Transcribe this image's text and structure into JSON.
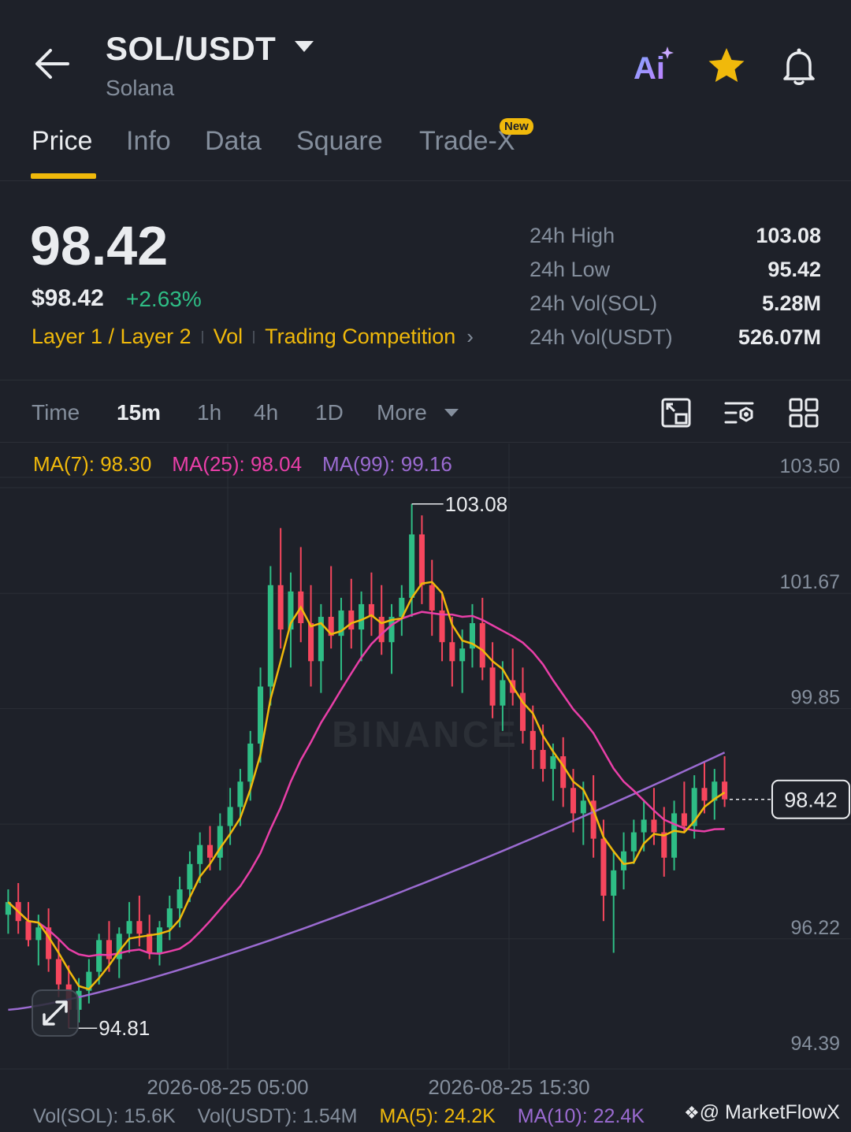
{
  "header": {
    "pair": "SOL/USDT",
    "name": "Solana",
    "ai_label": "Ai"
  },
  "tabs": [
    {
      "label": "Price",
      "active": true
    },
    {
      "label": "Info"
    },
    {
      "label": "Data"
    },
    {
      "label": "Square"
    },
    {
      "label": "Trade-X",
      "badge": "New"
    }
  ],
  "price": {
    "last": "98.42",
    "usd": "$98.42",
    "change": "+2.63%",
    "tags": [
      "Layer 1 / Layer 2",
      "Vol",
      "Trading Competition"
    ]
  },
  "stats": [
    {
      "label": "24h High",
      "value": "103.08"
    },
    {
      "label": "24h Low",
      "value": "95.42"
    },
    {
      "label": "24h Vol(SOL)",
      "value": "5.28M"
    },
    {
      "label": "24h Vol(USDT)",
      "value": "526.07M"
    }
  ],
  "intervals": {
    "time": "Time",
    "items": [
      "15m",
      "1h",
      "4h",
      "1D"
    ],
    "active": "15m",
    "more": "More"
  },
  "ma_legend": {
    "ma7": "MA(7): 98.30",
    "ma25": "MA(25): 98.04",
    "ma99": "MA(99): 99.16"
  },
  "chart_data": {
    "type": "candlestick",
    "y_axis_ticks": [
      "103.50",
      "101.67",
      "99.85",
      "98.42",
      "96.22",
      "94.39"
    ],
    "y_range": [
      94.39,
      103.5
    ],
    "x_axis_ticks": [
      "2026-08-25 05:00",
      "2026-08-25 15:30"
    ],
    "last_price_label": "98.42",
    "high_marker": "103.08",
    "low_marker": "94.81",
    "watermark": "BINANCE",
    "colors": {
      "up": "#2ebd85",
      "down": "#f6465d",
      "ma7": "#f0b90b",
      "ma25": "#e93fa8",
      "ma99": "#9b6bd1"
    },
    "candles": [
      [
        96.6,
        97.0,
        96.3,
        96.8
      ],
      [
        96.8,
        97.1,
        96.3,
        96.5
      ],
      [
        96.5,
        96.8,
        96.1,
        96.2
      ],
      [
        96.2,
        96.6,
        95.8,
        96.4
      ],
      [
        96.4,
        96.7,
        95.7,
        95.9
      ],
      [
        95.9,
        96.2,
        95.3,
        95.5
      ],
      [
        95.5,
        95.8,
        94.81,
        95.1
      ],
      [
        95.1,
        95.6,
        94.9,
        95.4
      ],
      [
        95.4,
        95.9,
        95.2,
        95.7
      ],
      [
        95.7,
        96.3,
        95.5,
        96.2
      ],
      [
        96.2,
        96.5,
        95.7,
        95.9
      ],
      [
        95.9,
        96.4,
        95.6,
        96.3
      ],
      [
        96.3,
        96.8,
        96.0,
        96.5
      ],
      [
        96.5,
        96.9,
        96.1,
        96.3
      ],
      [
        96.3,
        96.6,
        95.9,
        96.0
      ],
      [
        96.0,
        96.5,
        95.8,
        96.4
      ],
      [
        96.4,
        96.9,
        96.2,
        96.7
      ],
      [
        96.7,
        97.2,
        96.4,
        97.0
      ],
      [
        97.0,
        97.6,
        96.8,
        97.4
      ],
      [
        97.4,
        97.9,
        97.1,
        97.7
      ],
      [
        97.7,
        98.0,
        97.3,
        97.5
      ],
      [
        97.5,
        98.2,
        97.3,
        98.0
      ],
      [
        98.0,
        98.6,
        97.7,
        98.3
      ],
      [
        98.3,
        98.9,
        98.0,
        98.7
      ],
      [
        98.7,
        99.5,
        98.4,
        99.3
      ],
      [
        99.3,
        100.5,
        99.0,
        100.2
      ],
      [
        100.2,
        102.1,
        99.9,
        101.8
      ],
      [
        101.8,
        102.7,
        100.8,
        101.1
      ],
      [
        101.1,
        102.0,
        100.5,
        101.7
      ],
      [
        101.7,
        102.4,
        100.9,
        101.2
      ],
      [
        101.2,
        101.8,
        100.2,
        100.6
      ],
      [
        100.6,
        101.5,
        100.1,
        101.3
      ],
      [
        101.3,
        102.1,
        100.8,
        101.0
      ],
      [
        101.0,
        101.6,
        100.3,
        101.4
      ],
      [
        101.4,
        101.9,
        100.8,
        101.1
      ],
      [
        101.1,
        101.7,
        100.6,
        101.5
      ],
      [
        101.5,
        102.0,
        101.0,
        101.3
      ],
      [
        101.3,
        101.8,
        100.7,
        100.9
      ],
      [
        100.9,
        101.5,
        100.4,
        101.3
      ],
      [
        101.3,
        101.8,
        101.0,
        101.6
      ],
      [
        101.6,
        103.08,
        101.3,
        102.6
      ],
      [
        102.6,
        102.9,
        101.5,
        101.8
      ],
      [
        101.8,
        102.2,
        101.0,
        101.4
      ],
      [
        101.4,
        101.7,
        100.6,
        100.9
      ],
      [
        100.9,
        101.3,
        100.2,
        100.6
      ],
      [
        100.6,
        101.1,
        100.1,
        100.8
      ],
      [
        100.8,
        101.5,
        100.5,
        101.2
      ],
      [
        101.2,
        101.6,
        100.3,
        100.5
      ],
      [
        100.5,
        100.9,
        99.7,
        99.9
      ],
      [
        99.9,
        100.6,
        99.5,
        100.3
      ],
      [
        100.3,
        100.8,
        99.9,
        100.1
      ],
      [
        100.1,
        100.5,
        99.3,
        99.5
      ],
      [
        99.5,
        99.9,
        98.9,
        99.2
      ],
      [
        99.2,
        99.6,
        98.7,
        98.9
      ],
      [
        98.9,
        99.3,
        98.4,
        99.1
      ],
      [
        99.1,
        99.4,
        98.3,
        98.6
      ],
      [
        98.6,
        98.9,
        97.9,
        98.2
      ],
      [
        98.2,
        98.7,
        97.7,
        98.4
      ],
      [
        98.4,
        98.8,
        97.5,
        97.8
      ],
      [
        97.8,
        98.1,
        96.5,
        96.9
      ],
      [
        96.9,
        97.6,
        96.0,
        97.3
      ],
      [
        97.3,
        97.9,
        97.0,
        97.6
      ],
      [
        97.6,
        98.1,
        97.4,
        97.9
      ],
      [
        97.9,
        98.4,
        97.6,
        98.1
      ],
      [
        98.1,
        98.6,
        97.7,
        97.9
      ],
      [
        97.9,
        98.3,
        97.2,
        97.5
      ],
      [
        97.5,
        98.4,
        97.3,
        98.2
      ],
      [
        98.2,
        98.7,
        97.9,
        98.0
      ],
      [
        98.0,
        98.8,
        97.8,
        98.6
      ],
      [
        98.6,
        99.0,
        98.2,
        98.4
      ],
      [
        98.4,
        98.9,
        98.1,
        98.7
      ],
      [
        98.7,
        99.1,
        98.3,
        98.42
      ]
    ]
  },
  "volume_legend": {
    "vol_sol": "Vol(SOL): 15.6K",
    "vol_usdt": "Vol(USDT): 1.54M",
    "ma5": "MA(5): 24.2K",
    "ma10": "MA(10): 22.4K"
  },
  "credit": "@ MarketFlowX"
}
